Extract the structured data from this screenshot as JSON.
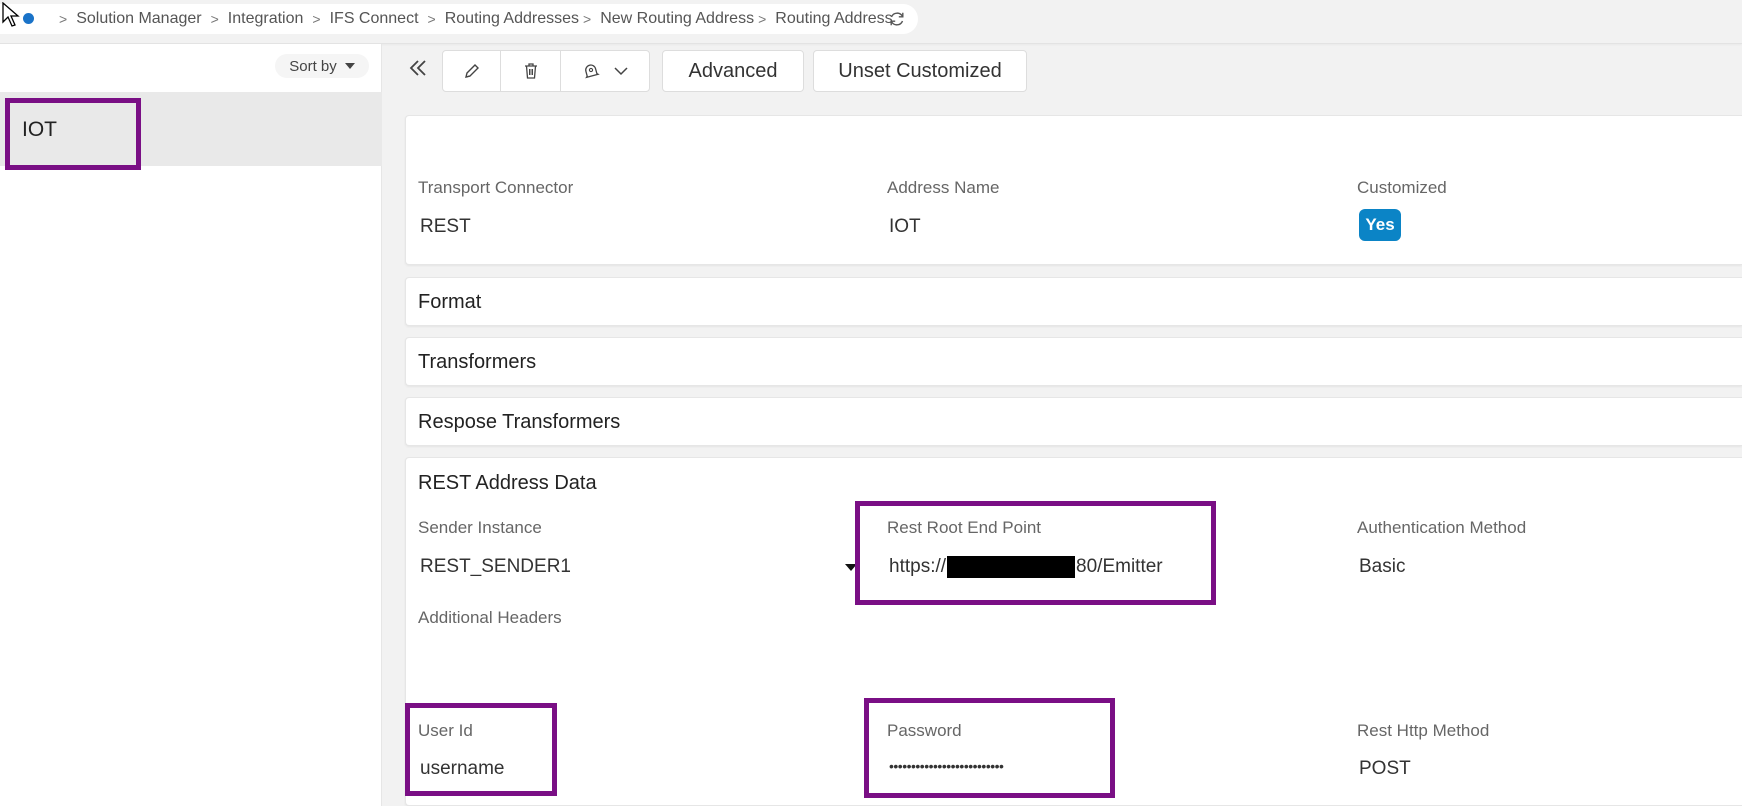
{
  "breadcrumb": {
    "items": [
      "Solution Manager",
      "Integration",
      "IFS Connect",
      "Routing Addresses",
      "New Routing Address",
      "Routing Address"
    ]
  },
  "left_panel": {
    "sort_label": "Sort by",
    "items": [
      {
        "label": "IOT"
      }
    ]
  },
  "toolbar": {
    "advanced_label": "Advanced",
    "unset_customized_label": "Unset Customized"
  },
  "header_card": {
    "transport_connector_label": "Transport Connector",
    "transport_connector_value": "REST",
    "address_name_label": "Address Name",
    "address_name_value": "IOT",
    "customized_label": "Customized",
    "customized_value": "Yes"
  },
  "sections": {
    "format": "Format",
    "transformers": "Transformers",
    "response_transformers": "Respose Transformers"
  },
  "rest_address_data": {
    "title": "REST Address Data",
    "sender_instance_label": "Sender Instance",
    "sender_instance_value": "REST_SENDER1",
    "rest_root_label": "Rest Root End Point",
    "rest_root_prefix": "https://",
    "rest_root_suffix": "80/Emitter",
    "auth_method_label": "Authentication Method",
    "auth_method_value": "Basic",
    "additional_headers_label": "Additional Headers",
    "user_id_label": "User Id",
    "user_id_value": "username",
    "password_label": "Password",
    "password_value": "••••••••••••••••••••••••••",
    "http_method_label": "Rest Http Method",
    "http_method_value": "POST"
  },
  "colors": {
    "accent": "#0b84c6",
    "highlight": "#7a0f85",
    "home_dot": "#1a73c8"
  },
  "icons": [
    "cursor-icon",
    "home-icon",
    "chevron-right-icon",
    "refresh-icon",
    "double-chevron-left-icon",
    "edit-icon",
    "delete-icon",
    "notification-icon",
    "chevron-down-icon",
    "caret-down-icon"
  ]
}
